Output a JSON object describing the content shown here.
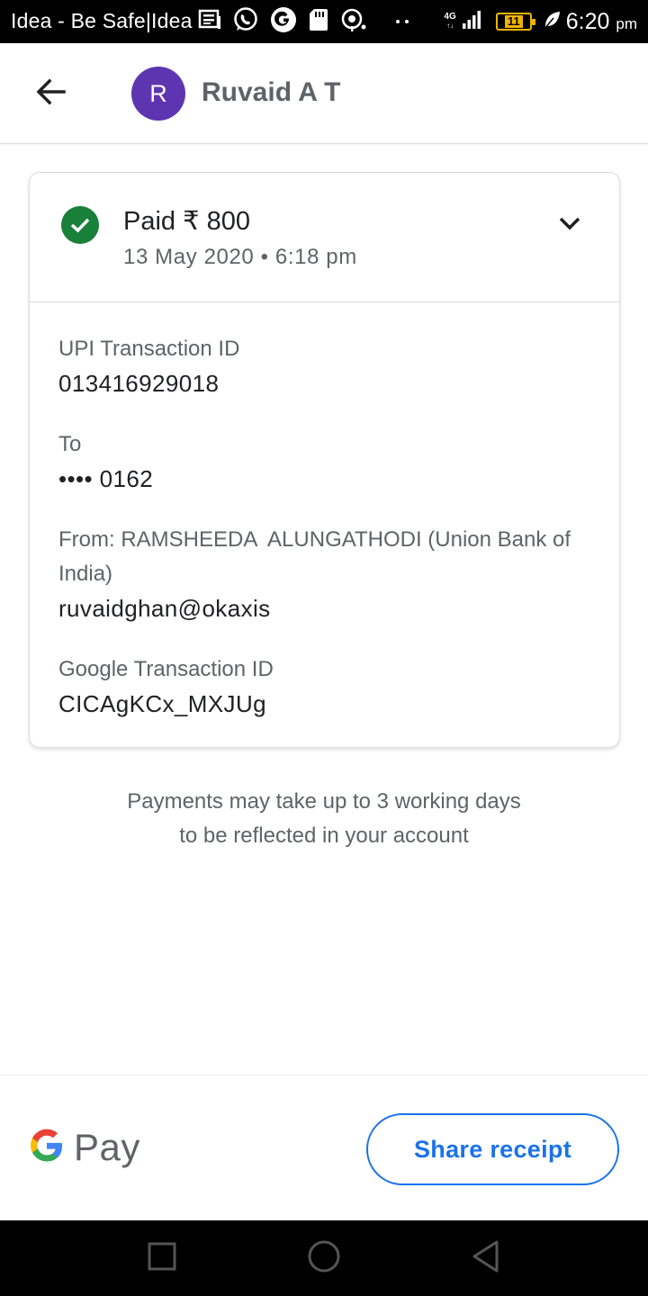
{
  "status_bar": {
    "carrier": "Idea - Be Safe|Idea",
    "network": "4G",
    "battery": "11",
    "time": "6:20",
    "ampm": "pm",
    "icons": [
      "news-icon",
      "whatsapp-icon",
      "google-icon",
      "sd-card-icon",
      "hotspot-icon",
      "dots-icon",
      "signal-icon",
      "battery-icon",
      "leaf-icon"
    ]
  },
  "header": {
    "back_icon": "arrow-back-icon",
    "avatar_letter": "R",
    "avatar_color": "#5e35b1",
    "contact_name": "Ruvaid A T"
  },
  "transaction": {
    "status_icon": "check-circle-icon",
    "status_color": "#188038",
    "amount_text": "Paid ₹ 800",
    "datetime": "13 May 2020 • 6:18 pm",
    "expand_icon": "chevron-down-icon",
    "upi_id_label": "UPI Transaction ID",
    "upi_id_value": "013416929018",
    "to_label": "To",
    "to_value": "•••• 0162",
    "from_label": "From: RAMSHEEDA  ALUNGATHODI (Union Bank of India)",
    "from_value": "ruvaidghan@okaxis",
    "google_id_label": "Google Transaction ID",
    "google_id_value": "CICAgKCx_MXJUg"
  },
  "note": {
    "line1": "Payments may take up to 3 working days",
    "line2": "to be reflected in your account"
  },
  "footer": {
    "brand": "Pay",
    "brand_icon": "google-g-logo",
    "share_label": "Share receipt",
    "accent_color": "#1a73e8"
  },
  "nav_bar": {
    "icons": [
      "recents-square-icon",
      "home-circle-icon",
      "back-triangle-icon"
    ]
  }
}
